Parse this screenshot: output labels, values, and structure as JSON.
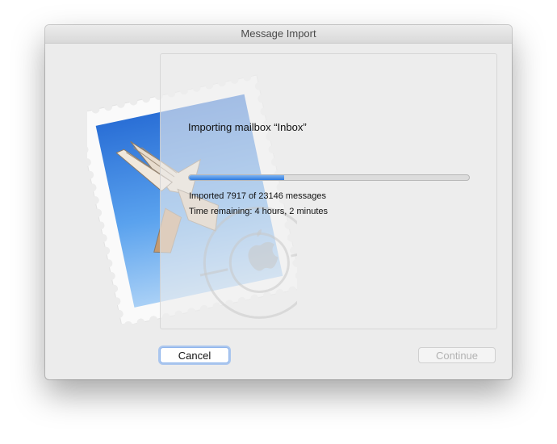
{
  "window": {
    "title": "Message Import"
  },
  "import": {
    "heading": "Importing mailbox “Inbox”",
    "progress_fraction": 0.34,
    "imported_text": "Imported 7917 of 23146 messages",
    "time_remaining_text": "Time remaining: 4 hours, 2 minutes"
  },
  "stamp": {
    "postmark_text": "HELLO FROM CALIFORNIA",
    "icon": "mail-stamp-icon"
  },
  "buttons": {
    "cancel_label": "Cancel",
    "continue_label": "Continue"
  },
  "colors": {
    "accent": "#2f7de1",
    "disabled_text": "#b2b2b2"
  }
}
